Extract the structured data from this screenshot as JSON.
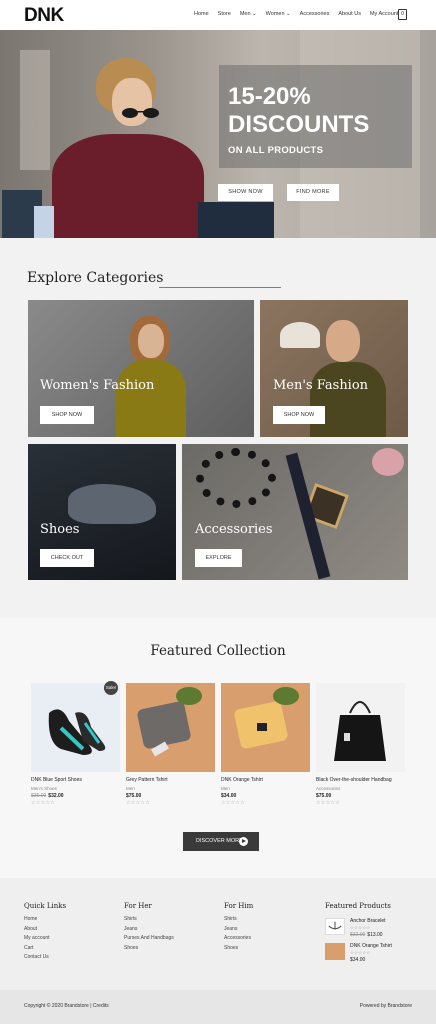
{
  "header": {
    "logo": "DNK",
    "nav": [
      "Home",
      "Store",
      "Men ⌄",
      "Women ⌄",
      "Accessories",
      "About Us",
      "My Account"
    ],
    "cart_count": "0"
  },
  "hero": {
    "title_line1": "15-20%",
    "title_line2": "DISCOUNTS",
    "subtitle": "ON ALL PRODUCTS",
    "btn_show": "SHOW NOW",
    "btn_find": "FIND MORE"
  },
  "categories": {
    "title": "Explore Categories",
    "items": [
      {
        "label": "Women's Fashion",
        "button": "SHOP NOW"
      },
      {
        "label": "Men's Fashion",
        "button": "SHOP NOW"
      },
      {
        "label": "Shoes",
        "button": "CHECK OUT"
      },
      {
        "label": "Accessories",
        "button": "EXPLORE"
      }
    ]
  },
  "featured": {
    "title": "Featured Collection",
    "sale_badge": "Sale!",
    "products": [
      {
        "name": "DNK Blue Sport Shoes",
        "category": "Men's Shoes",
        "old_price": "$35.00",
        "price": "$32.00",
        "stars": "☆☆☆☆☆"
      },
      {
        "name": "Grey Pattern Tshirt",
        "category": "Men",
        "old_price": "",
        "price": "$75.00",
        "stars": "☆☆☆☆☆"
      },
      {
        "name": "DNK Orange Tshirt",
        "category": "Men",
        "old_price": "",
        "price": "$34.00",
        "stars": "☆☆☆☆☆"
      },
      {
        "name": "Black Over-the-shoulder Handbag",
        "category": "Accessories",
        "old_price": "",
        "price": "$75.00",
        "stars": "☆☆☆☆☆"
      }
    ],
    "discover": "DISCOVER MORE"
  },
  "footer": {
    "quick_links": {
      "title": "Quick Links",
      "items": [
        "Home",
        "About",
        "My account",
        "Cart",
        "Contact Us"
      ]
    },
    "for_her": {
      "title": "For Her",
      "items": [
        "Shirts",
        "Jeans",
        "Purses And Handbags",
        "Shoes"
      ]
    },
    "for_him": {
      "title": "For Him",
      "items": [
        "Shirts",
        "Jeans",
        "Accessories",
        "Shoes"
      ]
    },
    "featured_products": {
      "title": "Featured Products",
      "items": [
        {
          "name": "Anchor Bracelet",
          "stars": "☆☆☆☆☆",
          "old_price": "$32.00",
          "price": "$13.00"
        },
        {
          "name": "DNK Orange Tshirt",
          "stars": "☆☆☆☆☆",
          "price": "$34.00"
        }
      ]
    },
    "copyright": "Copyright © 2020 Brandstore | Credits",
    "powered": "Powered by Brandstore"
  }
}
